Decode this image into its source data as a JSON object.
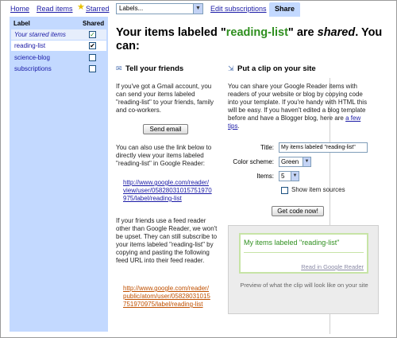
{
  "nav": {
    "home": "Home",
    "read_items": "Read items",
    "starred": "Starred",
    "labels_select": "Labels...",
    "edit_subscriptions": "Edit subscriptions",
    "share_tab": "Share"
  },
  "sidebar": {
    "col_label": "Label",
    "col_shared": "Shared",
    "items": [
      {
        "label": "Your starred items",
        "shared": true,
        "mark": "✓"
      },
      {
        "label": "reading-list",
        "shared": true,
        "mark": "✔"
      },
      {
        "label": "science-blog",
        "shared": false,
        "mark": ""
      },
      {
        "label": "subscriptions",
        "shared": false,
        "mark": ""
      }
    ]
  },
  "headline": {
    "prefix": "Your items labeled \"",
    "label": "reading-list",
    "middle": "\" are ",
    "shared": "shared",
    "suffix": ". You can:"
  },
  "tell_friends": {
    "title": "Tell your friends",
    "para1": "If you've got a Gmail account, you can send your items labeled \"reading-list\" to your friends, family and co-workers.",
    "send_email": "Send email",
    "para2": "You can also use the link below to directly view your items labeled \"reading-list\" in Google Reader:",
    "view_url": "http://www.google.com/reader/view/user/05828031015751970975/label/reading-list",
    "para3": "If your friends use a feed reader other than Google Reader, we won't be upset. They can still subscribe to your items labeled \"reading-list\" by copying and pasting the following feed URL into their feed reader.",
    "feed_url": "http://www.google.com/reader/public/atom/user/05828031015751970975/label/reading-list"
  },
  "clip": {
    "title": "Put a clip on your site",
    "para_before": "You can share your Google Reader items with readers of your website or blog by copying code into your template. If you're handy with HTML this will be easy. If you haven't edited a blog template before and have a Blogger blog, here are ",
    "para_link": "a few tips",
    "para_after": ".",
    "title_label": "Title:",
    "title_value": "My items labeled \"reading-list\"",
    "scheme_label": "Color scheme:",
    "scheme_value": "Green",
    "items_label": "Items:",
    "items_value": "5",
    "show_sources": "Show item sources",
    "get_code": "Get code now!",
    "preview_title": "My items labeled \"reading-list\"",
    "preview_link": "Read in Google Reader",
    "preview_caption": "Preview of what the clip will look like on your site"
  },
  "colors": {
    "sidebar_bg": "#c3d9ff",
    "label_green": "#2f8f1f",
    "link_blue": "#1a1aa6",
    "feed_orange": "#c05000"
  }
}
